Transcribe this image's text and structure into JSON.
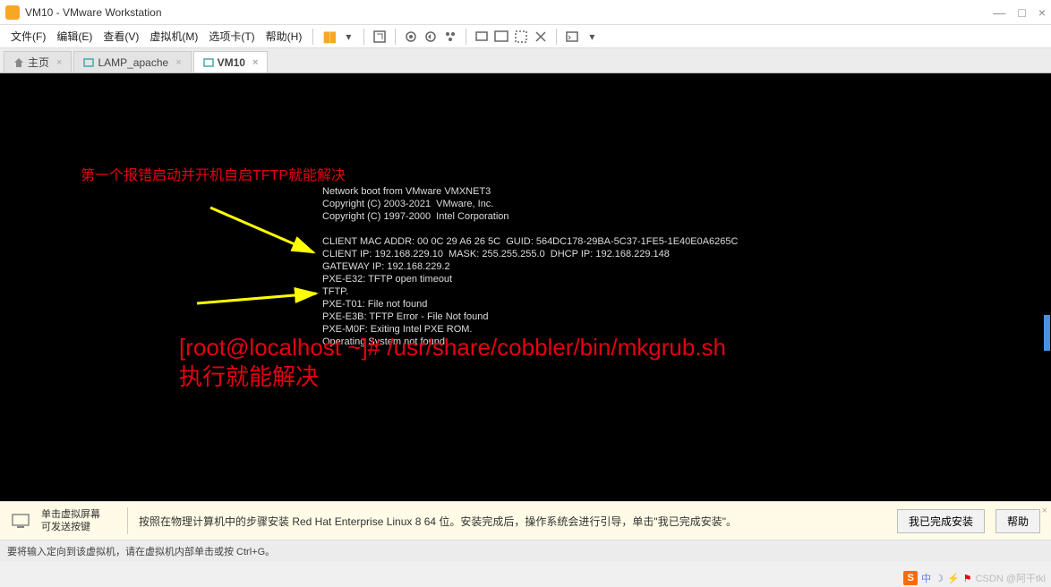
{
  "window": {
    "title": "VM10 - VMware Workstation",
    "minimize": "—",
    "maximize": "□",
    "close": "×"
  },
  "menu": {
    "file": "文件(F)",
    "edit": "编辑(E)",
    "view": "查看(V)",
    "vm": "虚拟机(M)",
    "tabs": "选项卡(T)",
    "help": "帮助(H)"
  },
  "tabs": {
    "home": "主页",
    "t1": "LAMP_apache",
    "t2": "VM10"
  },
  "annotations": {
    "line1": "第一个报错启动并开机自启TFTP就能解决",
    "cmd": "[root@localhost ~]# /usr/share/cobbler/bin/mkgrub.sh",
    "cmd2": "执行就能解决"
  },
  "boot": {
    "l1": "Network boot from VMware VMXNET3",
    "l2": "Copyright (C) 2003-2021  VMware, Inc.",
    "l3": "Copyright (C) 1997-2000  Intel Corporation",
    "l4": "",
    "l5": "CLIENT MAC ADDR: 00 0C 29 A6 26 5C  GUID: 564DC178-29BA-5C37-1FE5-1E40E0A6265C",
    "l6": "CLIENT IP: 192.168.229.10  MASK: 255.255.255.0  DHCP IP: 192.168.229.148",
    "l7": "GATEWAY IP: 192.168.229.2",
    "l8": "PXE-E32: TFTP open timeout",
    "l9": "TFTP.",
    "l10": "PXE-T01: File not found",
    "l11": "PXE-E3B: TFTP Error - File Not found",
    "l12": "PXE-M0F: Exiting Intel PXE ROM.",
    "l13": "Operating System not found"
  },
  "info": {
    "left1": "单击虚拟屏幕",
    "left2": "可发送按键",
    "text": "按照在物理计算机中的步骤安装 Red Hat Enterprise Linux 8 64 位。安装完成后，操作系统会进行引导，单击\"我已完成安装\"。",
    "btn_done": "我已完成安装",
    "btn_help": "帮助"
  },
  "status": {
    "text": "要将输入定向到该虚拟机，请在虚拟机内部单击或按 Ctrl+G。"
  },
  "tray": {
    "watermark": "CSDN @阿干tkl",
    "s": "S",
    "zhong": "中"
  }
}
